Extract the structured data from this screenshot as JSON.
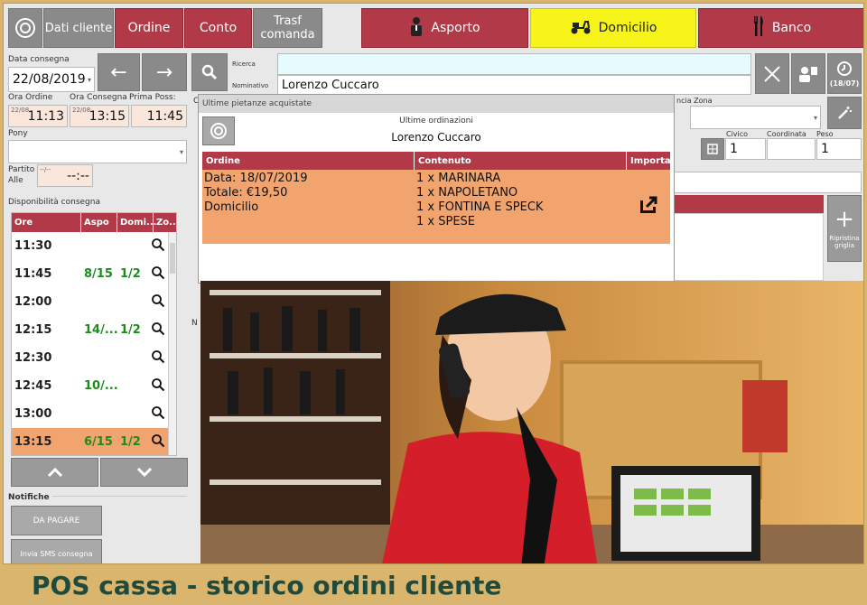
{
  "header": {
    "logo_icon": "target-logo-icon",
    "tabs": [
      {
        "label": "Dati cliente"
      },
      {
        "label": "Ordine"
      },
      {
        "label": "Conto"
      },
      {
        "label": "Trasf\ncomanda"
      }
    ],
    "modes": [
      {
        "label": "Asporto",
        "icon": "person-icon"
      },
      {
        "label": "Domicilio",
        "icon": "scooter-icon"
      },
      {
        "label": "Banco",
        "icon": "cutlery-icon"
      }
    ]
  },
  "delivery": {
    "date_label": "Data consegna",
    "date_value": "22/08/2019",
    "order_time_label": "Ora Ordine",
    "order_time_small": "22/08",
    "order_time_value": "11:13",
    "delivery_time_label": "Ora Consegna",
    "delivery_time_small": "22/08",
    "delivery_time_value": "13:15",
    "first_label": "Prima Poss:",
    "first_value": "11:45",
    "pony_label": "Pony",
    "partito_label": "Partito",
    "alle_label": "Alle",
    "partito_small": "--/--",
    "partito_value": "--:--",
    "availability_label": "Disponibilità consegna"
  },
  "availability": {
    "columns": [
      "Ore",
      "Aspo",
      "Domi...",
      "Zo..."
    ],
    "rows": [
      {
        "time": "11:30",
        "aspo": "",
        "domi": ""
      },
      {
        "time": "11:45",
        "aspo": "8/15",
        "domi": "1/2"
      },
      {
        "time": "12:00",
        "aspo": "",
        "domi": ""
      },
      {
        "time": "12:15",
        "aspo": "14/...",
        "domi": "1/2"
      },
      {
        "time": "12:30",
        "aspo": "",
        "domi": ""
      },
      {
        "time": "12:45",
        "aspo": "10/...",
        "domi": ""
      },
      {
        "time": "13:00",
        "aspo": "",
        "domi": ""
      },
      {
        "time": "13:15",
        "aspo": "6/15",
        "domi": "1/2"
      }
    ],
    "selected_index": 7
  },
  "notifications": {
    "label": "Notifiche",
    "pay_button": "DA PAGARE",
    "sms_button": "Invia SMS consegna"
  },
  "search": {
    "ricerca_label": "Ricerca",
    "nominativo_label": "Nominativo",
    "nominativo_value": "Lorenzo Cuccaro",
    "counter_label": "(18/07)",
    "zona_label": "ncia Zona",
    "civico_label": "Civico",
    "civico_value": "1",
    "coordinata_label": "Coordinata",
    "peso_label": "Peso",
    "peso_value": "1",
    "reset_label": "Ripristina griglia"
  },
  "popup": {
    "title": "Ultime pietanze acquistate",
    "subtitle": "Ultime ordinazioni",
    "customer": "Lorenzo Cuccaro",
    "columns": [
      "Ordine",
      "Contenuto",
      "Importa"
    ],
    "order": {
      "date": "Data: 18/07/2019",
      "total": "Totale: €19,50",
      "type": "Domicilio",
      "items": [
        "1 x MARINARA",
        "1 x NAPOLETANO",
        "1 x FONTINA E SPECK",
        "1 x SPESE"
      ]
    }
  },
  "caption": "POS cassa - storico ordini cliente",
  "colors": {
    "accent": "#b23a48",
    "highlight": "#f1a46e",
    "yellow": "#f6f418",
    "caption": "#1e4b3e"
  }
}
